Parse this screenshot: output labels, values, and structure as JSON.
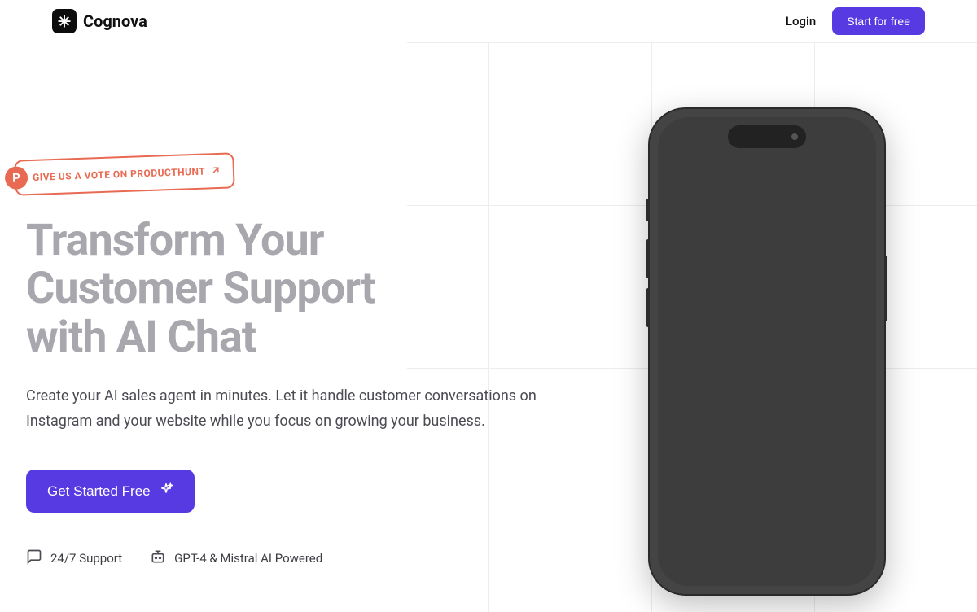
{
  "header": {
    "brand_name": "Cognova",
    "login_label": "Login",
    "start_free_label": "Start for free"
  },
  "producthunt": {
    "badge_letter": "P",
    "text": "GIVE US A VOTE ON PRODUCTHUNT"
  },
  "hero": {
    "title_line1": "Transform Your",
    "title_line2": "Customer Support",
    "title_line3": "with AI Chat",
    "subtitle": "Create your AI sales agent in minutes. Let it handle customer conversations on Instagram and your website while you focus on growing your business.",
    "cta_label": "Get Started Free"
  },
  "features": [
    {
      "icon": "chat-icon",
      "label": "24/7 Support"
    },
    {
      "icon": "bot-icon",
      "label": "GPT-4 & Mistral AI Powered"
    }
  ],
  "colors": {
    "accent": "#583ae2",
    "producthunt": "#e86a52"
  }
}
